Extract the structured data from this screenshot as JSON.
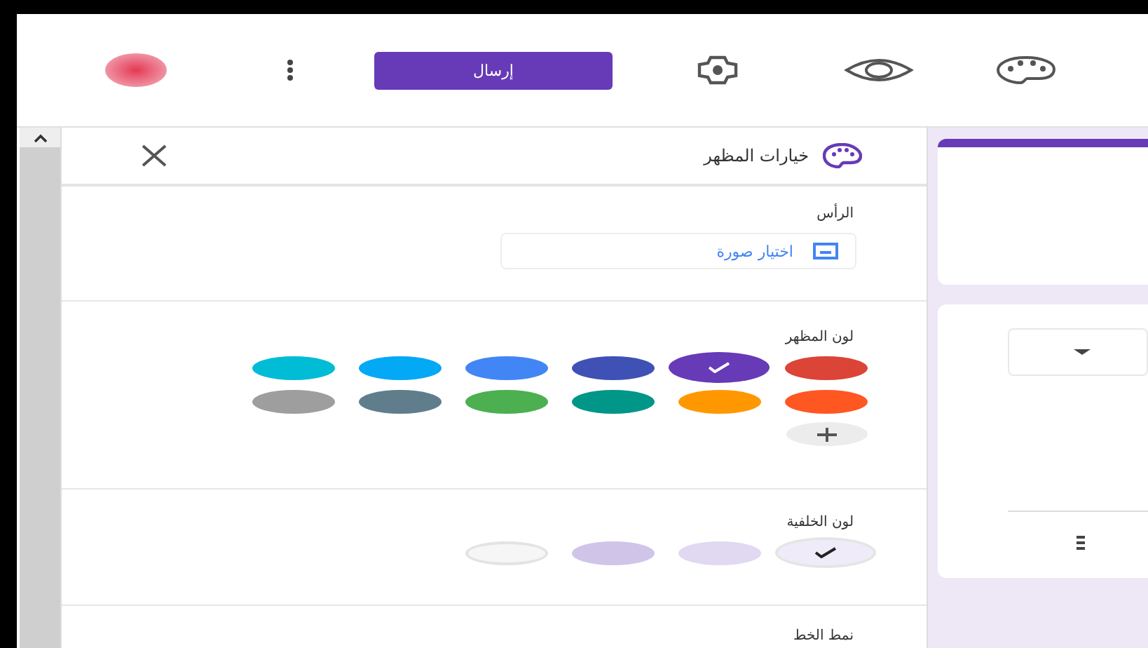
{
  "toolbar": {
    "send_button": "إرسال"
  },
  "theme_panel": {
    "title": "خيارات المظهر",
    "header": {
      "label": "الرأس",
      "choose_image": "اختيار صورة"
    },
    "theme_color": {
      "label": "لون المظهر",
      "swatches": [
        {
          "color": "#db4437",
          "selected": false
        },
        {
          "color": "#673ab7",
          "selected": true
        },
        {
          "color": "#3f51b5",
          "selected": false
        },
        {
          "color": "#4285f4",
          "selected": false
        },
        {
          "color": "#03a9f4",
          "selected": false
        },
        {
          "color": "#00bcd4",
          "selected": false
        },
        {
          "color": "#ff5722",
          "selected": false
        },
        {
          "color": "#ff9800",
          "selected": false
        },
        {
          "color": "#009688",
          "selected": false
        },
        {
          "color": "#4caf50",
          "selected": false
        },
        {
          "color": "#607d8b",
          "selected": false
        },
        {
          "color": "#9e9e9e",
          "selected": false
        }
      ]
    },
    "background_color": {
      "label": "لون الخلفية",
      "swatches": [
        {
          "color": "#f0ebf8",
          "selected": true
        },
        {
          "color": "#e1d8f1",
          "selected": false
        },
        {
          "color": "#d1c4e9",
          "selected": false
        },
        {
          "color": "#f6f6f6",
          "selected": false
        }
      ]
    },
    "font_style": {
      "label": "نمط الخط"
    }
  }
}
